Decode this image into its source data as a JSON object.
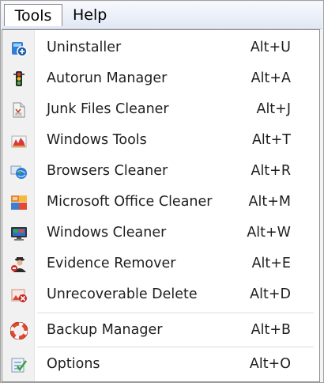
{
  "menubar": {
    "tools_label": "Tools",
    "help_label": "Help"
  },
  "menu": {
    "items": [
      {
        "label": "Uninstaller",
        "shortcut": "Alt+U",
        "icon": "uninstaller-icon"
      },
      {
        "label": "Autorun Manager",
        "shortcut": "Alt+A",
        "icon": "traffic-light-icon"
      },
      {
        "label": "Junk Files Cleaner",
        "shortcut": "Alt+J",
        "icon": "junk-files-icon"
      },
      {
        "label": "Windows Tools",
        "shortcut": "Alt+T",
        "icon": "windows-tools-icon"
      },
      {
        "label": "Browsers Cleaner",
        "shortcut": "Alt+R",
        "icon": "browser-globe-icon"
      },
      {
        "label": "Microsoft Office Cleaner",
        "shortcut": "Alt+M",
        "icon": "office-icon"
      },
      {
        "label": "Windows Cleaner",
        "shortcut": "Alt+W",
        "icon": "monitor-icon"
      },
      {
        "label": "Evidence Remover",
        "shortcut": "Alt+E",
        "icon": "evidence-agent-icon"
      },
      {
        "label": "Unrecoverable Delete",
        "shortcut": "Alt+D",
        "icon": "shredder-icon"
      },
      {
        "label": "Backup Manager",
        "shortcut": "Alt+B",
        "icon": "lifebuoy-icon"
      },
      {
        "label": "Options",
        "shortcut": "Alt+O",
        "icon": "options-checklist-icon"
      }
    ]
  }
}
